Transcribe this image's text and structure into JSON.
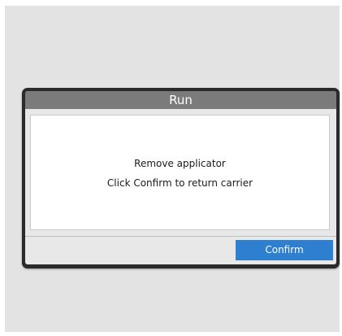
{
  "dialog": {
    "title": "Run",
    "message_line1": "Remove applicator",
    "message_line2": "Click Confirm to return carrier",
    "confirm_label": "Confirm"
  },
  "colors": {
    "background": "#e3e3e3",
    "dialog_border": "#2a2a2a",
    "titlebar": "#7b7b7b",
    "confirm_button": "#2f7fd0"
  }
}
